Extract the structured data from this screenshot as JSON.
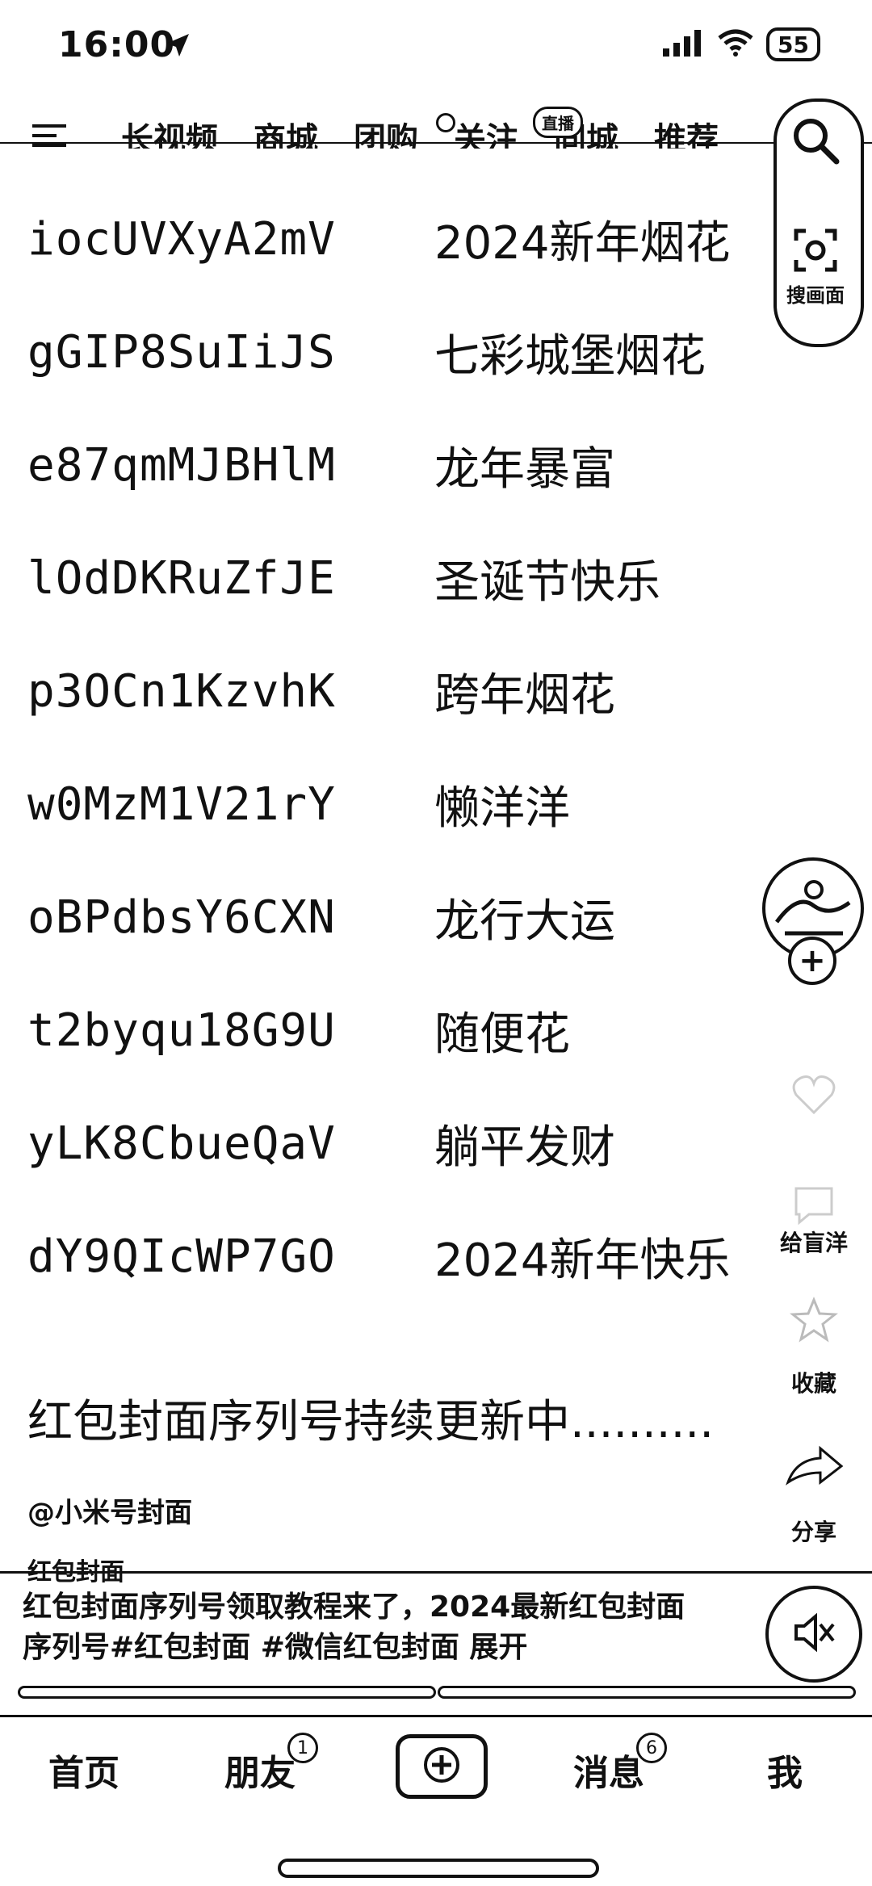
{
  "status_bar": {
    "time": "16:00",
    "battery": "55"
  },
  "nav": {
    "tabs": [
      "长视频",
      "商城",
      "团购",
      "关注",
      "同城",
      "推荐"
    ],
    "live_badge": "直播"
  },
  "search": {
    "scan_label": "搜画面"
  },
  "codes": [
    {
      "code": "iocUVXyA2mV",
      "name": "2024新年烟花"
    },
    {
      "code": "gGIP8SuIiJS",
      "name": "七彩城堡烟花"
    },
    {
      "code": "e87qmMJBHlM",
      "name": "龙年暴富"
    },
    {
      "code": "lOdDKRuZfJE",
      "name": "圣诞节快乐"
    },
    {
      "code": "p3OCn1KzvhK",
      "name": "跨年烟花"
    },
    {
      "code": "w0MzM1V21rY",
      "name": "懒洋洋"
    },
    {
      "code": "oBPdbsY6CXN",
      "name": "龙行大运"
    },
    {
      "code": "t2byqu18G9U",
      "name": "随便花"
    },
    {
      "code": "yLK8CbueQaV",
      "name": "躺平发财"
    },
    {
      "code": "dY9QIcWP7GO",
      "name": "2024新年快乐"
    }
  ],
  "update_note": "红包封面序列号持续更新中..........",
  "side": {
    "follow": "+",
    "like_label": "",
    "comment_label": "给盲洋",
    "favorite_label": "收藏",
    "share_label": "分享"
  },
  "video": {
    "author": "@小米号封面",
    "tagline": "红包封面",
    "caption": "红包封面序列号领取教程来了，2024最新红包封面序列号#红包封面 #微信红包封面 展开"
  },
  "tabbar": {
    "home": "首页",
    "friends": "朋友",
    "friends_badge": "1",
    "messages": "消息",
    "messages_badge": "6",
    "me": "我"
  }
}
